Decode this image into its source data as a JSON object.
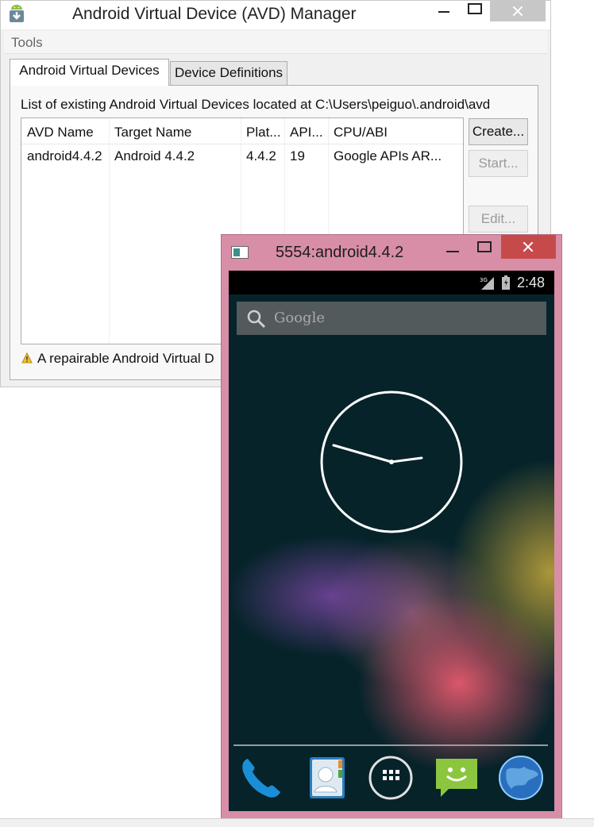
{
  "avd_window": {
    "title": "Android Virtual Device (AVD) Manager",
    "menu": {
      "tools": "Tools"
    },
    "tabs": [
      {
        "label": "Android Virtual Devices",
        "selected": true
      },
      {
        "label": "Device Definitions",
        "selected": false
      }
    ],
    "list_caption": "List of existing Android Virtual Devices located at C:\\Users\\peiguo\\.android\\avd",
    "table": {
      "columns": [
        "AVD Name",
        "Target Name",
        "Plat...",
        "API...",
        "CPU/ABI"
      ],
      "rows": [
        [
          "android4.4.2",
          "Android 4.4.2",
          "4.4.2",
          "19",
          "Google APIs AR..."
        ]
      ]
    },
    "buttons": {
      "create": "Create...",
      "start": "Start...",
      "edit": "Edit..."
    },
    "warning_text": "A repairable Android Virtual D"
  },
  "emulator_window": {
    "title": "5554:android4.4.2",
    "status_time": "2:48",
    "network_type": "3G",
    "search_placeholder": "Google",
    "analog_clock": {
      "hour": 2,
      "minute": 48
    },
    "dock": [
      "phone-icon",
      "contacts-icon",
      "all-apps-icon",
      "messaging-icon",
      "browser-icon"
    ]
  },
  "colors": {
    "emulator_frame": "#d88ea6",
    "close_button_active": "#c74a4a",
    "screen_background": "#06232a"
  }
}
